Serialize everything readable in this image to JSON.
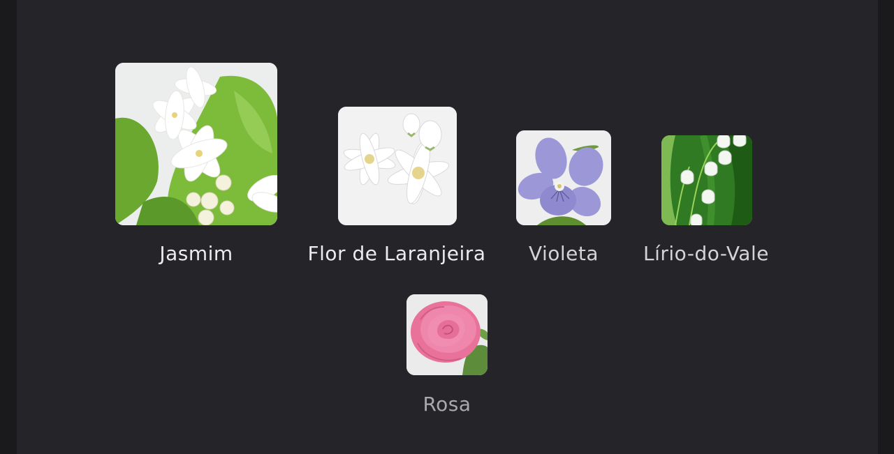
{
  "notes": [
    {
      "name": "Jasmim",
      "image_icon": "jasmine-flower-icon",
      "emphasis": "bright"
    },
    {
      "name": "Flor de Laranjeira",
      "image_icon": "orange-blossom-icon",
      "emphasis": "bright"
    },
    {
      "name": "Violeta",
      "image_icon": "violet-flower-icon",
      "emphasis": "mid"
    },
    {
      "name": "Lírio-do-Vale",
      "image_icon": "lily-of-the-valley-icon",
      "emphasis": "mid"
    },
    {
      "name": "Rosa",
      "image_icon": "rose-flower-icon",
      "emphasis": "dim"
    }
  ],
  "colors": {
    "background": "#252529",
    "label_bright": "#ececee",
    "label_mid": "#d4d4d8",
    "label_dim": "#a9a9ae"
  }
}
